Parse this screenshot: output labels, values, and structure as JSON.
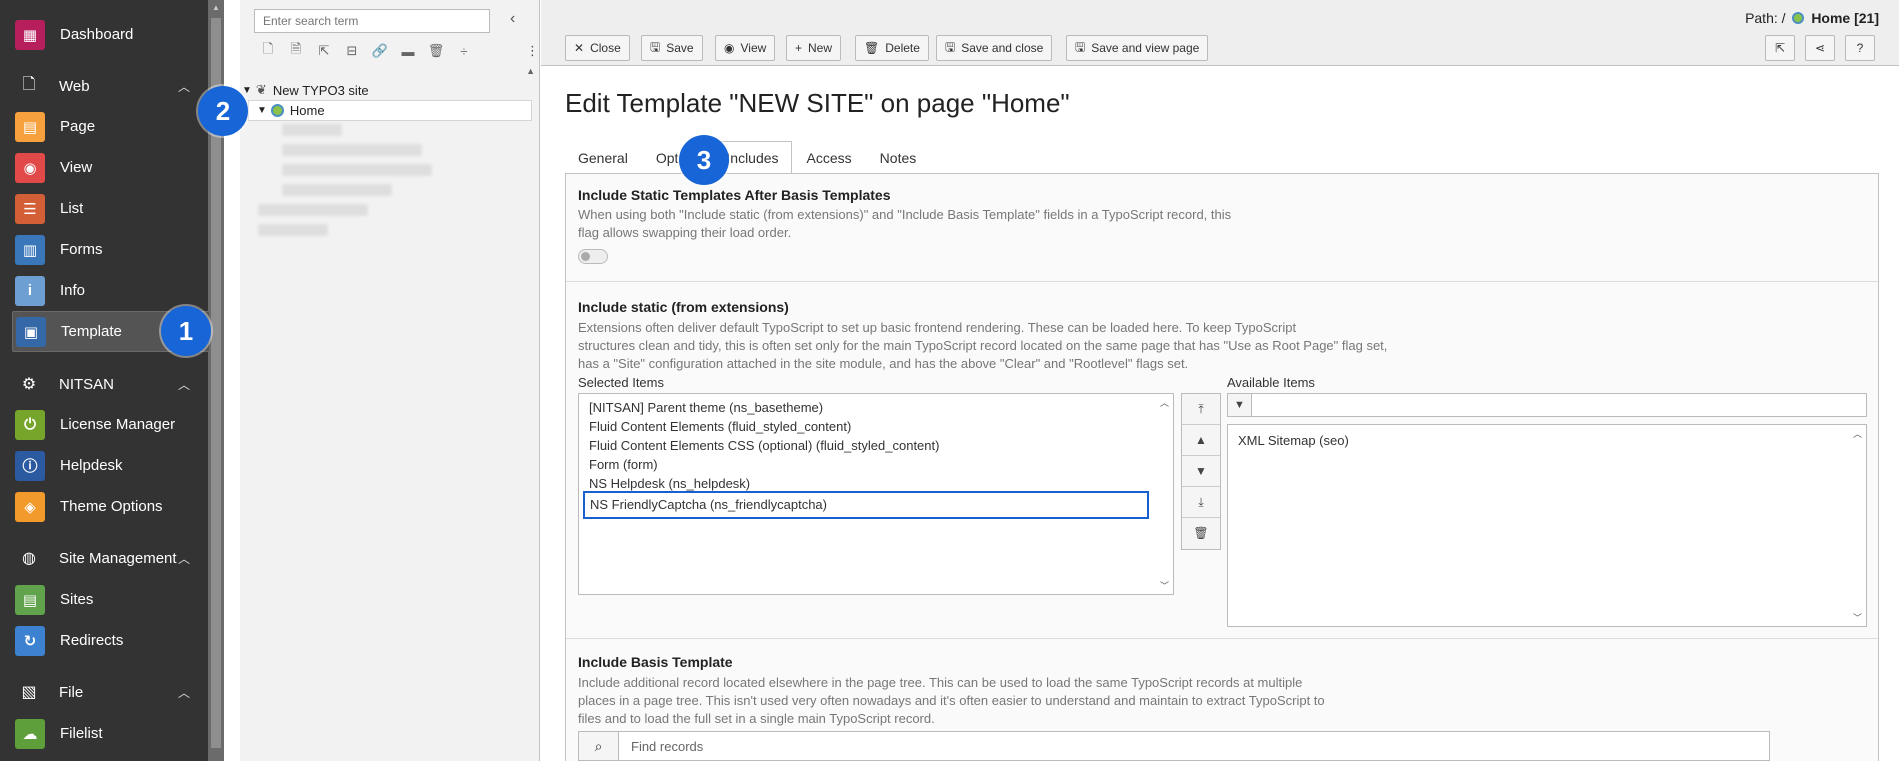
{
  "modmenu": {
    "groups": [
      {
        "label": "Dashboard",
        "icon": "dashboard-icon",
        "color": "#b71f5c"
      },
      {
        "label": "Web"
      },
      {
        "label": "NITSAN"
      },
      {
        "label": "Site Management"
      },
      {
        "label": "File"
      }
    ],
    "web_items": [
      {
        "label": "Page",
        "icon": "page-icon",
        "color": "#f6a13e"
      },
      {
        "label": "View",
        "icon": "view-icon",
        "color": "#e24a4a"
      },
      {
        "label": "List",
        "icon": "list-icon",
        "color": "#d35f36"
      },
      {
        "label": "Forms",
        "icon": "forms-icon",
        "color": "#3a77ba"
      },
      {
        "label": "Info",
        "icon": "info-icon",
        "color": "#6d9fd2"
      },
      {
        "label": "Template",
        "icon": "template-icon",
        "color": "#3568a6"
      }
    ],
    "nitsan_items": [
      {
        "label": "License Manager",
        "icon": "power-icon",
        "color": "#75a52b"
      },
      {
        "label": "Helpdesk",
        "icon": "info-circle-icon",
        "color": "#2c5aa0"
      },
      {
        "label": "Theme Options",
        "icon": "box-icon",
        "color": "#f39a2c"
      }
    ],
    "site_items": [
      {
        "label": "Sites",
        "icon": "sites-icon",
        "color": "#61a34d"
      },
      {
        "label": "Redirects",
        "icon": "redirect-icon",
        "color": "#3c82d0"
      }
    ],
    "file_items": [
      {
        "label": "Filelist",
        "icon": "filelist-icon",
        "color": "#5f9f3b"
      }
    ]
  },
  "callouts": [
    "1",
    "2",
    "3"
  ],
  "tree": {
    "search_placeholder": "Enter search term",
    "root": "New TYPO3 site",
    "selected": "Home"
  },
  "header": {
    "path_prefix": "Path: /",
    "path_page": "Home [21]",
    "buttons": {
      "close": "Close",
      "save": "Save",
      "view": "View",
      "new": "New",
      "delete": "Delete",
      "save_close": "Save and close",
      "save_view": "Save and view page"
    },
    "help": "?"
  },
  "main": {
    "title": "Edit Template \"NEW SITE\" on page \"Home\"",
    "tabs": [
      "General",
      "Opt",
      "Includes",
      "Access",
      "Notes"
    ],
    "section1": {
      "title": "Include Static Templates After Basis Templates",
      "desc1": "When using both \"Include static (from extensions)\" and \"Include Basis Template\" fields in a TypoScript record, this",
      "desc2": "flag allows swapping their load order."
    },
    "section2": {
      "title": "Include static (from extensions)",
      "desc1": "Extensions often deliver default TypoScript to set up basic frontend rendering. These can be loaded here. To keep TypoScript",
      "desc2": "structures clean and tidy, this is often set only for the main TypoScript record located on the same page that has \"Use as Root Page\" flag set,",
      "desc3": "has a \"Site\" configuration attached in the site module, and has the above \"Clear\" and \"Rootlevel\" flags set.",
      "selected_label": "Selected Items",
      "available_label": "Available Items",
      "selected_items": [
        "[NITSAN] Parent theme (ns_basetheme)",
        "Fluid Content Elements (fluid_styled_content)",
        "Fluid Content Elements CSS (optional) (fluid_styled_content)",
        "Form (form)",
        "NS Helpdesk (ns_helpdesk)",
        "NS FriendlyCaptcha (ns_friendlycaptcha)"
      ],
      "available_items": [
        "XML Sitemap (seo)"
      ]
    },
    "section3": {
      "title": "Include Basis Template",
      "desc1": "Include additional record located elsewhere in the page tree. This can be used to load the same TypoScript records at multiple",
      "desc2": "places in a page tree. This isn't used very often nowadays and it's often easier to understand and maintain to extract TypoScript to",
      "desc3": "files and to load the full set in a single main TypoScript record.",
      "find_placeholder": "Find records"
    }
  }
}
